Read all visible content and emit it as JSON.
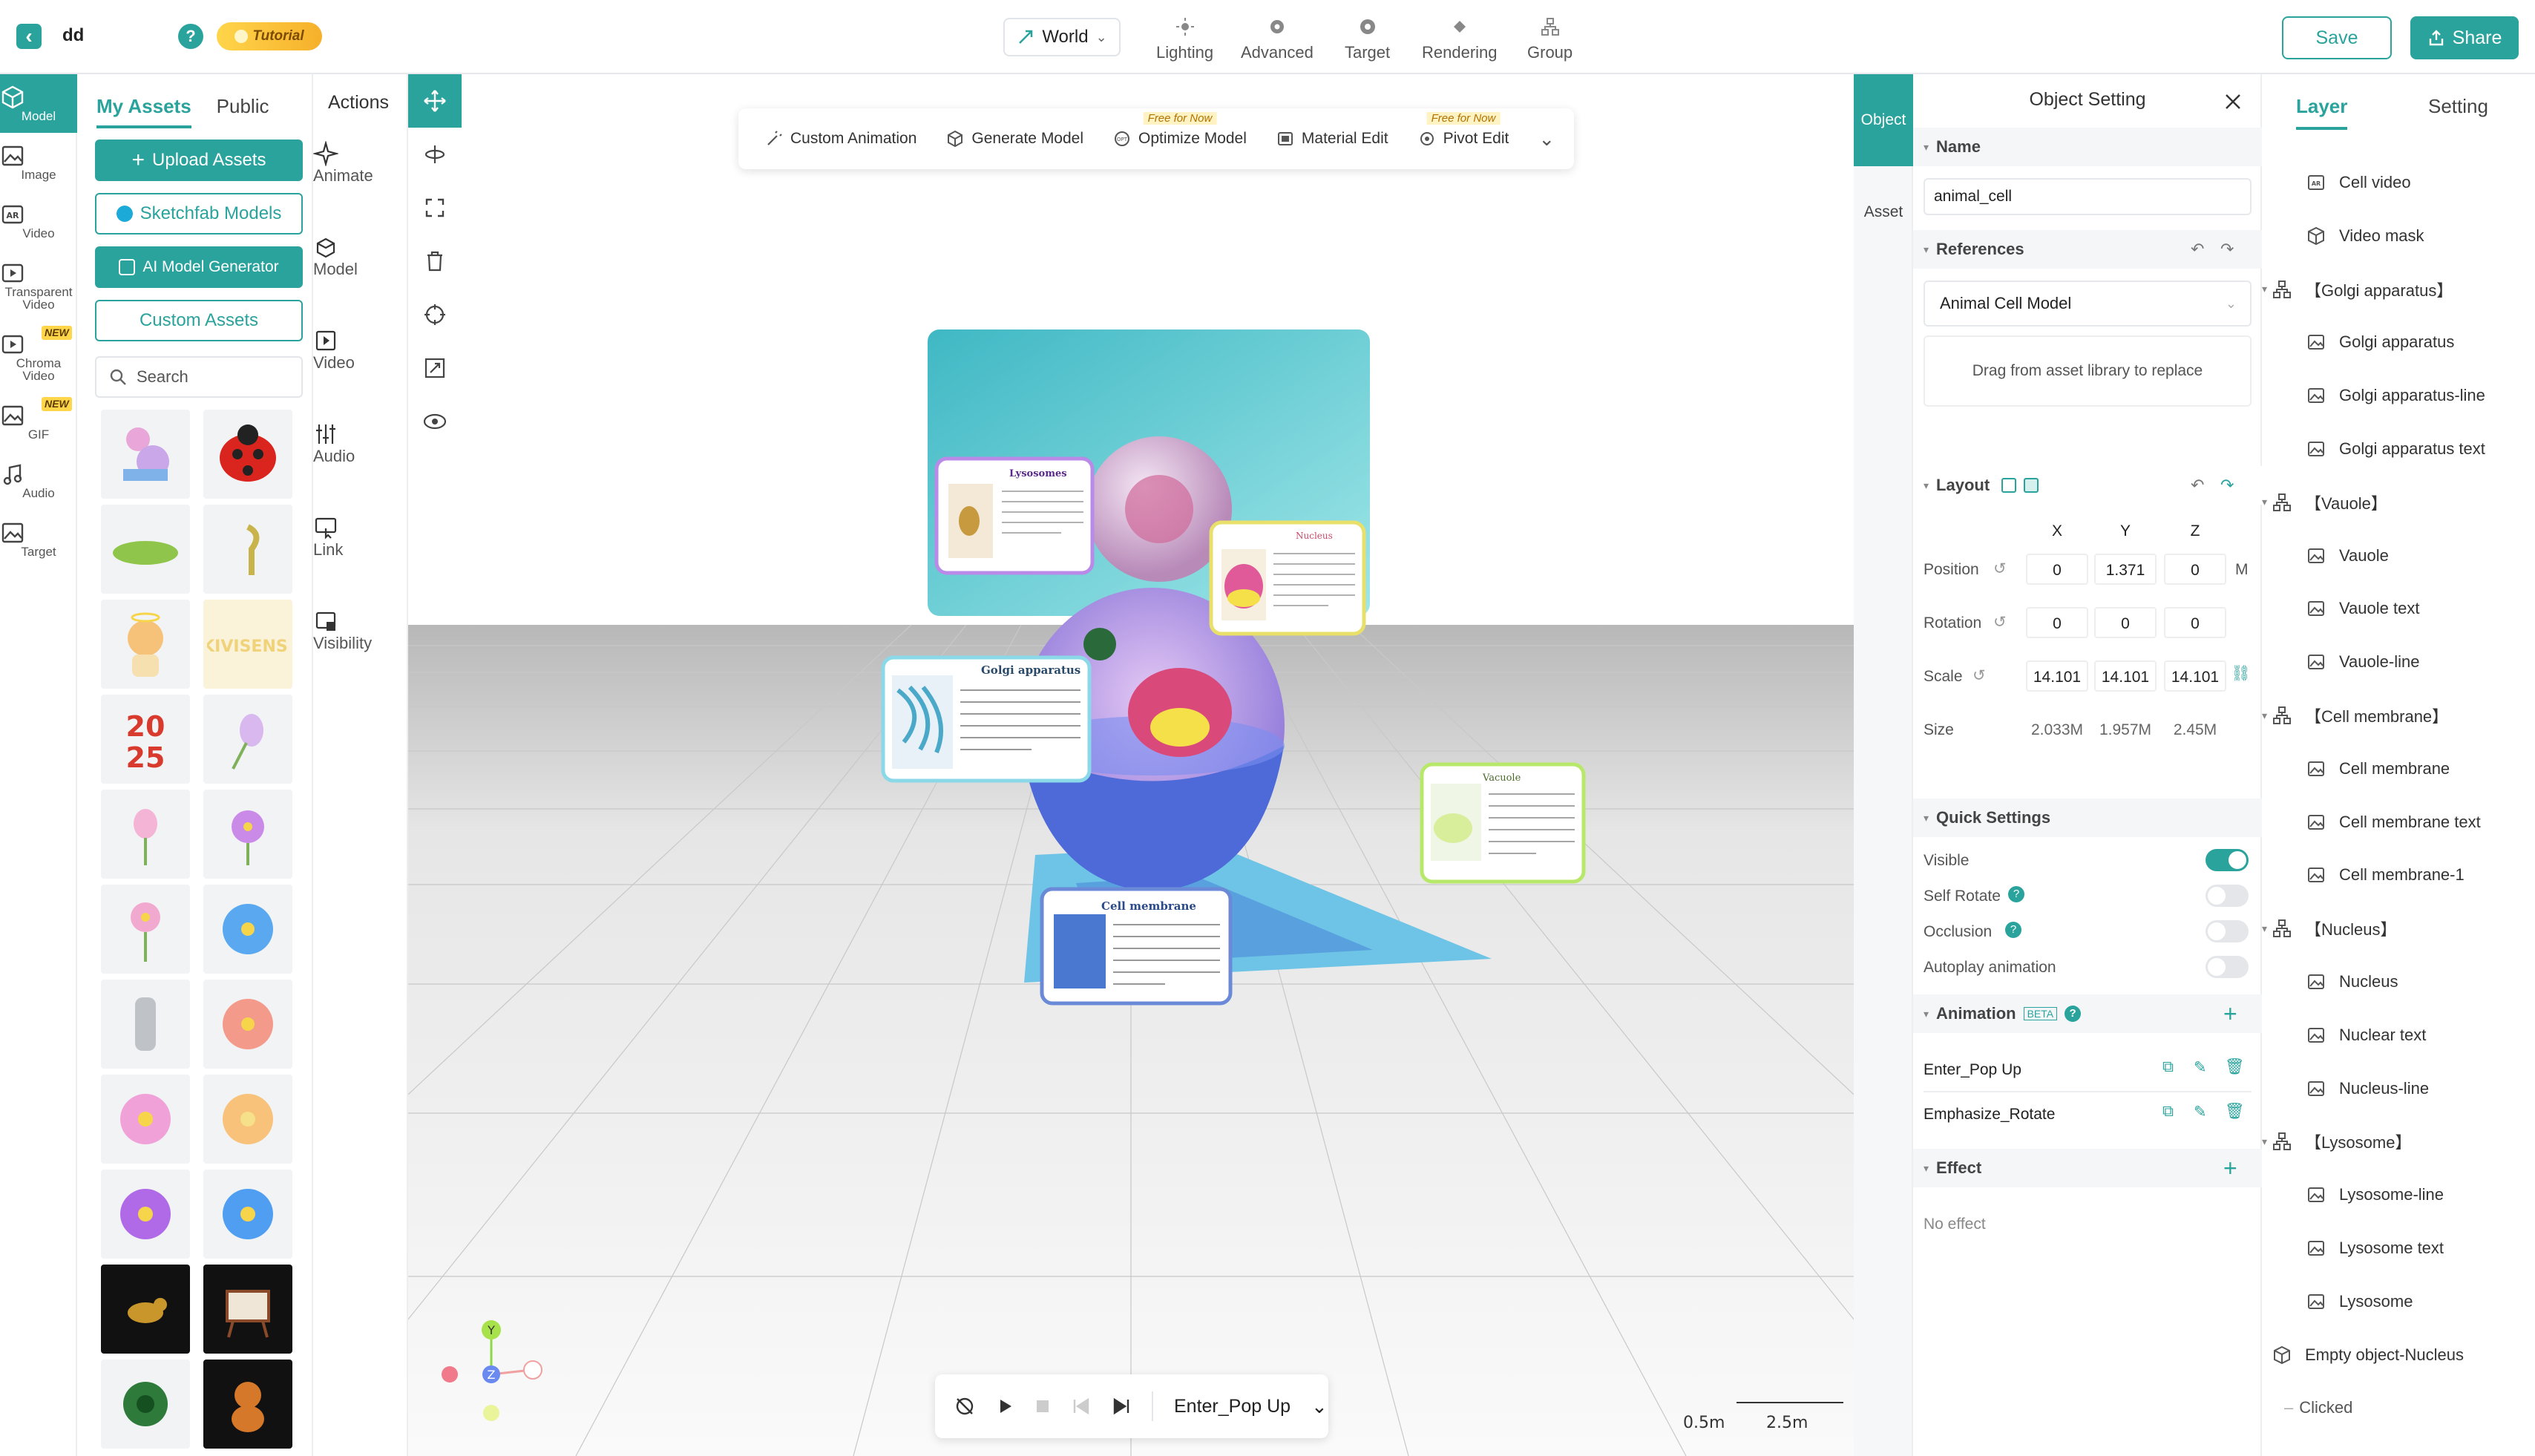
{
  "topbar": {
    "project_name": "dd",
    "help": "?",
    "tutorial": "Tutorial",
    "world_select": "World",
    "tools": [
      "Lighting",
      "Advanced",
      "Target",
      "Rendering",
      "Group"
    ],
    "save": "Save",
    "share": "Share"
  },
  "nav": [
    {
      "label": "Model",
      "icon": "cube-icon"
    },
    {
      "label": "Image",
      "icon": "image-icon"
    },
    {
      "label": "Video",
      "icon": "ar-video-icon"
    },
    {
      "label": "Transparent Video",
      "icon": "play-box-icon"
    },
    {
      "label": "Chroma Video",
      "icon": "chroma-video-icon",
      "badge": "NEW"
    },
    {
      "label": "GIF",
      "icon": "gif-icon",
      "badge": "NEW"
    },
    {
      "label": "Audio",
      "icon": "music-note-icon"
    },
    {
      "label": "Target",
      "icon": "target-icon"
    }
  ],
  "assets": {
    "tabs": [
      "My Assets",
      "Public"
    ],
    "upload": "Upload Assets",
    "sketchfab": "Sketchfab Models",
    "ai_generator": "AI Model Generator",
    "custom": "Custom Assets",
    "search_placeholder": "Search"
  },
  "actions": {
    "title": "Actions",
    "items": [
      "Animate",
      "Model",
      "Video",
      "Audio",
      "Link",
      "Visibility"
    ]
  },
  "viewport_toolbar": {
    "items": [
      "Custom Animation",
      "Generate Model",
      "Optimize Model",
      "Material Edit",
      "Pivot Edit"
    ],
    "free_badge": "Free for Now"
  },
  "scene_labels": [
    "Lysosomes",
    "Nucleus",
    "Golgi apparatus",
    "Vacuole",
    "Cell membrane"
  ],
  "player": {
    "animation": "Enter_Pop Up"
  },
  "scale_bar": {
    "left": "0.5m",
    "right": "2.5m"
  },
  "axes": {
    "y": "Y",
    "z": "Z"
  },
  "side_tabs": [
    "Object",
    "Asset"
  ],
  "object": {
    "title": "Object Setting",
    "name_section": "Name",
    "name_value": "animal_cell",
    "references_section": "References",
    "reference_value": "Animal Cell Model",
    "drag_hint": "Drag from asset library to replace",
    "layout_section": "Layout",
    "axes": [
      "X",
      "Y",
      "Z"
    ],
    "position_label": "Position",
    "position": [
      "0",
      "1.371",
      "0"
    ],
    "position_unit": "M",
    "rotation_label": "Rotation",
    "rotation": [
      "0",
      "0",
      "0"
    ],
    "scale_label": "Scale",
    "scale": [
      "14.101",
      "14.101",
      "14.101"
    ],
    "size_label": "Size",
    "size": [
      "2.033M",
      "1.957M",
      "2.45M"
    ],
    "quick_section": "Quick Settings",
    "visible": "Visible",
    "self_rotate": "Self Rotate",
    "occlusion": "Occlusion",
    "autoplay": "Autoplay animation",
    "animation_section": "Animation",
    "beta": "BETA",
    "animations": [
      "Enter_Pop Up",
      "Emphasize_Rotate"
    ],
    "effect_section": "Effect",
    "no_effect": "No effect"
  },
  "layer": {
    "tabs": [
      "Layer",
      "Setting"
    ],
    "rows": [
      {
        "label": "Cell video",
        "icon": "ar-icon",
        "level": 1
      },
      {
        "label": "Video mask",
        "icon": "cube-icon",
        "level": 1
      },
      {
        "label": "【Golgi apparatus】",
        "icon": "group-icon",
        "level": 0
      },
      {
        "label": "Golgi apparatus",
        "icon": "image-icon",
        "level": 1
      },
      {
        "label": "Golgi apparatus-line",
        "icon": "image-icon",
        "level": 1
      },
      {
        "label": "Golgi apparatus text",
        "icon": "image-icon",
        "level": 1
      },
      {
        "label": "【Vauole】",
        "icon": "group-icon",
        "level": 0
      },
      {
        "label": "Vauole",
        "icon": "image-icon",
        "level": 1
      },
      {
        "label": "Vauole text",
        "icon": "image-icon",
        "level": 1
      },
      {
        "label": "Vauole-line",
        "icon": "image-icon",
        "level": 1
      },
      {
        "label": "【Cell membrane】",
        "icon": "group-icon",
        "level": 0
      },
      {
        "label": "Cell membrane",
        "icon": "image-icon",
        "level": 1
      },
      {
        "label": "Cell membrane text",
        "icon": "image-icon",
        "level": 1
      },
      {
        "label": "Cell membrane-1",
        "icon": "image-icon",
        "level": 1
      },
      {
        "label": "【Nucleus】",
        "icon": "group-icon",
        "level": 0
      },
      {
        "label": "Nucleus",
        "icon": "image-icon",
        "level": 1
      },
      {
        "label": "Nuclear text",
        "icon": "image-icon",
        "level": 1
      },
      {
        "label": "Nucleus-line",
        "icon": "image-icon",
        "level": 1
      },
      {
        "label": "【Lysosome】",
        "icon": "group-icon",
        "level": 0
      },
      {
        "label": "Lysosome-line",
        "icon": "image-icon",
        "level": 1
      },
      {
        "label": "Lysosome text",
        "icon": "image-icon",
        "level": 1
      },
      {
        "label": "Lysosome",
        "icon": "image-icon",
        "level": 1
      },
      {
        "label": "Empty object-Nucleus",
        "icon": "cube-icon",
        "level": 0
      },
      {
        "label": "Clicked",
        "icon": "none",
        "level": 1
      }
    ]
  },
  "colors": {
    "accent": "#2aa39d",
    "badge": "#ffd54a"
  }
}
